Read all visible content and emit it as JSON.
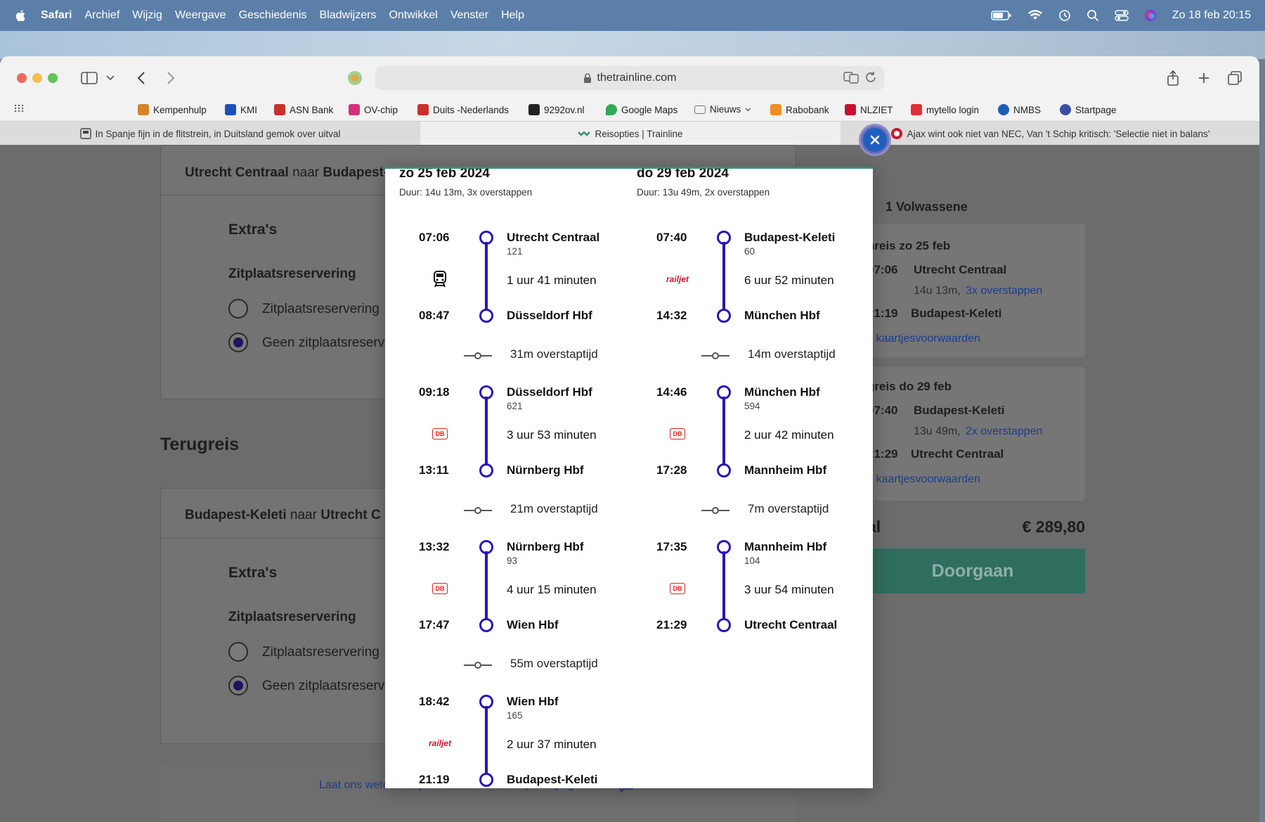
{
  "menubar": {
    "app": "Safari",
    "items": [
      "Archief",
      "Wijzig",
      "Weergave",
      "Geschiedenis",
      "Bladwijzers",
      "Ontwikkel",
      "Venster",
      "Help"
    ],
    "datetime": "Zo 18 feb 20:15"
  },
  "browser": {
    "url": "thetrainline.com",
    "bookmarks": [
      {
        "label": "Kempenhulp",
        "color": "#d9822b"
      },
      {
        "label": "KMI",
        "color": "#1d4fb8"
      },
      {
        "label": "ASN Bank",
        "color": "#c8302a"
      },
      {
        "label": "OV-chip",
        "color": "#d6307a"
      },
      {
        "label": "Duits -Nederlands",
        "color": "#c8302a"
      },
      {
        "label": "9292ov.nl",
        "color": "#222222"
      },
      {
        "label": "Google Maps",
        "color": "#34a853"
      },
      {
        "label": "Nieuws",
        "color": "#777777"
      },
      {
        "label": "Rabobank",
        "color": "#f28c28"
      },
      {
        "label": "NLZIET",
        "color": "#c8102e"
      },
      {
        "label": "mytello login",
        "color": "#e0303a"
      },
      {
        "label": "NMBS",
        "color": "#1b5fb8"
      },
      {
        "label": "Startpage",
        "color": "#3a4ea8"
      }
    ],
    "tabs": [
      {
        "title": "In Spanje fijn in de flitstrein, in Duitsland gemok over uitval",
        "active": false
      },
      {
        "title": "Reisopties | Trainline",
        "active": true
      },
      {
        "title": "Ajax wint ook niet van NEC, Van 't Schip kritisch: 'Selectie niet in balans'",
        "active": false
      }
    ]
  },
  "page": {
    "outbound_card": {
      "from": "Utrecht Centraal",
      "connector": "naar",
      "to": "Budapest-Keleti",
      "extras_heading": "Extra's",
      "seat_heading": "Zitplaatsreservering",
      "option_seat": "Zitplaatsreservering",
      "option_noseat": "Geen zitplaatsreserv"
    },
    "return_heading": "Terugreis",
    "return_card": {
      "from": "Budapest-Keleti",
      "connector": "naar",
      "to": "Utrecht C",
      "extras_heading": "Extra's",
      "seat_heading": "Zitplaatsreservering",
      "option_seat": "Zitplaatsreservering",
      "option_noseat": "Geen zitplaatsreserv"
    },
    "feedback_link": "Laat ons weten wat je denkt over onze zitplaatspagina",
    "summary": {
      "passengers": "1 Volwassene",
      "outbound": {
        "label": "nreis zo 25 feb",
        "dep_time": "07:06",
        "dep_station": "Utrecht Centraal",
        "duration": "14u 13m,",
        "changes": "3x overstappen",
        "arr_time": "21:19",
        "arr_station": "Budapest-Keleti",
        "conditions": "k kaartjesvoorwaarden"
      },
      "return": {
        "label": "greis do 29 feb",
        "dep_time": "07:40",
        "dep_station": "Budapest-Keleti",
        "duration": "13u 49m,",
        "changes": "2x overstappen",
        "arr_time": "21:29",
        "arr_station": "Utrecht Centraal",
        "conditions": "k kaartjesvoorwaarden"
      },
      "total_label": "al",
      "total_price": "€ 289,80",
      "continue_button": "Doorgaan"
    }
  },
  "modal": {
    "outbound": {
      "date": "zo 25 feb 2024",
      "duration": "Duur: 14u 13m, 3x overstappen",
      "segments": [
        {
          "dep_time": "07:06",
          "dep_station": "Utrecht Centraal",
          "train_no": "121",
          "duration": "1 uur 41 minuten",
          "arr_time": "08:47",
          "arr_station": "Düsseldorf Hbf",
          "operator": "train-icon"
        },
        {
          "dep_time": "09:18",
          "dep_station": "Düsseldorf Hbf",
          "train_no": "621",
          "duration": "3 uur 53 minuten",
          "arr_time": "13:11",
          "arr_station": "Nürnberg Hbf",
          "operator": "db-logo"
        },
        {
          "dep_time": "13:32",
          "dep_station": "Nürnberg Hbf",
          "train_no": "93",
          "duration": "4 uur 15 minuten",
          "arr_time": "17:47",
          "arr_station": "Wien Hbf",
          "operator": "db-logo"
        },
        {
          "dep_time": "18:42",
          "dep_station": "Wien Hbf",
          "train_no": "165",
          "duration": "2 uur 37 minuten",
          "arr_time": "21:19",
          "arr_station": "Budapest-Keleti",
          "operator": "railjet-logo"
        }
      ],
      "transfers": [
        "31m overstaptijd",
        "21m overstaptijd",
        "55m overstaptijd"
      ]
    },
    "return": {
      "date": "do 29 feb 2024",
      "duration": "Duur: 13u 49m, 2x overstappen",
      "segments": [
        {
          "dep_time": "07:40",
          "dep_station": "Budapest-Keleti",
          "train_no": "60",
          "duration": "6 uur 52 minuten",
          "arr_time": "14:32",
          "arr_station": "München Hbf",
          "operator": "railjet-logo"
        },
        {
          "dep_time": "14:46",
          "dep_station": "München Hbf",
          "train_no": "594",
          "duration": "2 uur 42 minuten",
          "arr_time": "17:28",
          "arr_station": "Mannheim Hbf",
          "operator": "db-logo"
        },
        {
          "dep_time": "17:35",
          "dep_station": "Mannheim Hbf",
          "train_no": "104",
          "duration": "3 uur 54 minuten",
          "arr_time": "21:29",
          "arr_station": "Utrecht Centraal",
          "operator": "db-logo"
        }
      ],
      "transfers": [
        "14m overstaptijd",
        "7m overstaptijd"
      ]
    },
    "operator_labels": {
      "db": "DB",
      "railjet": "railjet"
    }
  },
  "colors": {
    "route_line": "#2b14b8",
    "accent_green": "#3f8c7a",
    "continue_button": "#2f6e5f",
    "link_blue": "#1b3c8f"
  }
}
